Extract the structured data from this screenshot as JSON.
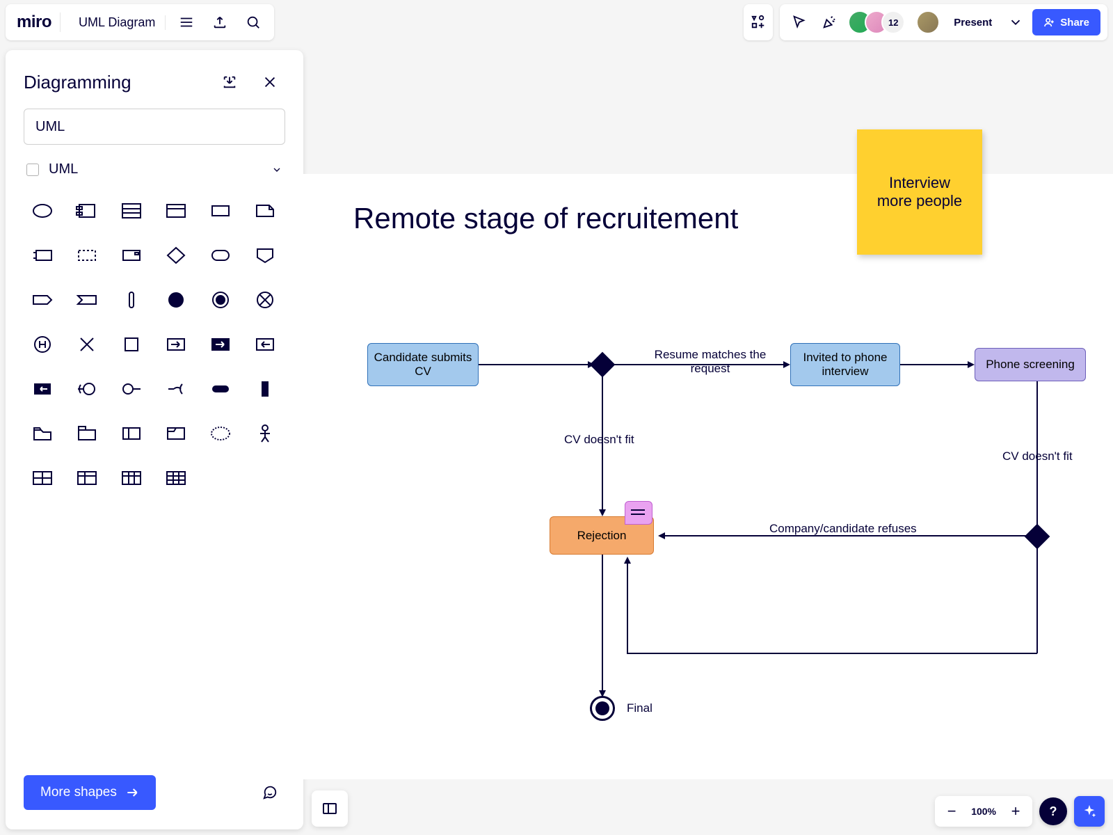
{
  "app": {
    "logo": "miro",
    "board_title": "UML Diagram"
  },
  "topbar": {
    "present_label": "Present",
    "share_label": "Share",
    "avatar_overflow_count": "12"
  },
  "sidepanel": {
    "title": "Diagramming",
    "search_value": "UML",
    "category_name": "UML",
    "more_shapes_label": "More shapes",
    "shapes": [
      "ellipse",
      "component",
      "class-3row",
      "class-header",
      "rect",
      "note",
      "send-signal",
      "dashed-rect",
      "panel",
      "decision-diamond",
      "rounded-rect",
      "interface-shield",
      "tag",
      "receive-signal",
      "bar-vert",
      "state-filled",
      "state-ring",
      "crossed-circle",
      "h-circle",
      "cross",
      "square",
      "arrow-box-out",
      "arrow-box-filled",
      "arrow-box-in",
      "black-box",
      "provided-interface",
      "required-interface",
      "assembly",
      "minus-pill",
      "bar-vert-thick",
      "folder",
      "package",
      "subsystem",
      "frame",
      "collab-dashed",
      "actor",
      "table-4",
      "table-2col",
      "table-3col",
      "table-grid"
    ]
  },
  "canvas": {
    "title": "Remote stage of recruitement",
    "sticky_note": "Interview more people",
    "nodes": {
      "submit": "Candidate submits CV",
      "invited": "Invited to phone interview",
      "screening": "Phone screening",
      "rejection": "Rejection",
      "final": "Final"
    },
    "edges": {
      "resume_matches": "Resume matches the request",
      "cv_nofit_1": "CV doesn't fit",
      "cv_nofit_2": "CV doesn't fit",
      "company_refuses": "Company/candidate refuses"
    }
  },
  "zoom": {
    "level": "100%"
  }
}
